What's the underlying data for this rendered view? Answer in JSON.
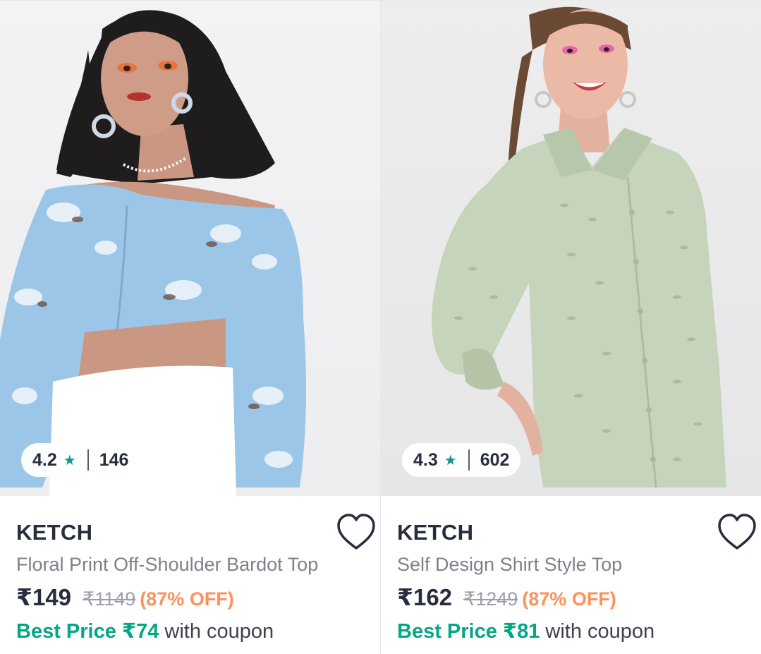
{
  "products": [
    {
      "rating": "4.2",
      "star": "★",
      "rating_count": "146",
      "brand": "KETCH",
      "title": "Floral Print Off-Shoulder Bardot Top",
      "price": "₹149",
      "mrp": "₹1149",
      "discount": "(87% OFF)",
      "best_price_label": "Best Price ₹74",
      "coupon_text": " with coupon",
      "wishlist_icon": "heart-outline-icon",
      "image_colors": {
        "top": "#9dc7e8",
        "pants": "#ffffff",
        "hair": "#1c1a1a",
        "skin": "#c9937c"
      }
    },
    {
      "rating": "4.3",
      "star": "★",
      "rating_count": "602",
      "brand": "KETCH",
      "title": "Self Design Shirt Style Top",
      "price": "₹162",
      "mrp": "₹1249",
      "discount": "(87% OFF)",
      "best_price_label": "Best Price ₹81",
      "coupon_text": " with coupon",
      "wishlist_icon": "heart-outline-icon",
      "image_colors": {
        "top": "#c8d6bd",
        "hair": "#6b4a33",
        "skin": "#e8b6a2"
      }
    }
  ],
  "colors": {
    "brand_text": "#282c3f",
    "discount": "#ff905a",
    "best_price": "#03a685",
    "star": "#14958f"
  }
}
